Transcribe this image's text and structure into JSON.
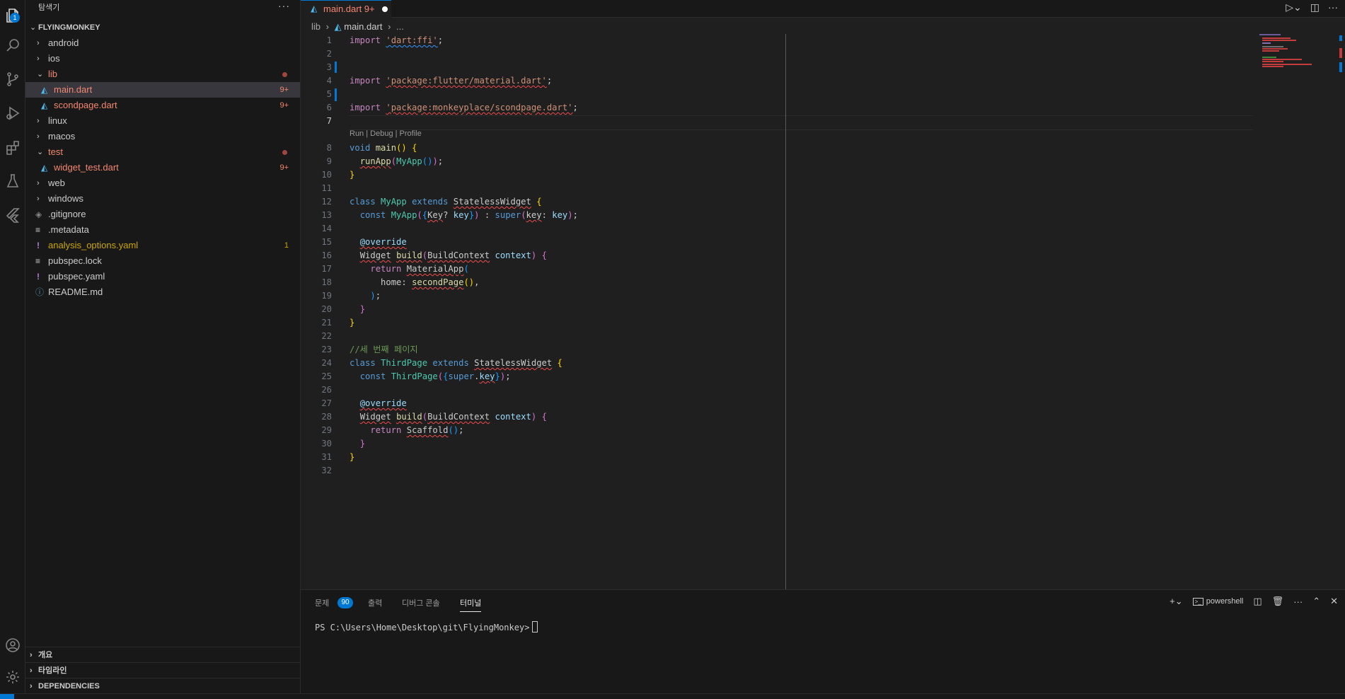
{
  "explorer": {
    "title": "탐색기",
    "more": "···",
    "root": "FLYINGMONKEY",
    "items": [
      {
        "label": "android",
        "chev": "›",
        "indent": 0
      },
      {
        "label": "ios",
        "chev": "›",
        "indent": 0
      },
      {
        "label": "lib",
        "chev": "⌄",
        "indent": 0
      },
      {
        "label": "main.dart",
        "badge": "9+"
      },
      {
        "label": "scondpage.dart",
        "badge": "9+"
      },
      {
        "label": "linux",
        "chev": "›"
      },
      {
        "label": "macos",
        "chev": "›"
      },
      {
        "label": "test",
        "chev": "⌄"
      },
      {
        "label": "widget_test.dart",
        "badge": "9+"
      },
      {
        "label": "web",
        "chev": "›"
      },
      {
        "label": "windows",
        "chev": "›"
      },
      {
        "label": ".gitignore",
        "icon": "◈"
      },
      {
        "label": ".metadata",
        "icon": "≡"
      },
      {
        "label": "analysis_options.yaml",
        "icon": "!",
        "badge": "1"
      },
      {
        "label": "pubspec.lock",
        "icon": "≡"
      },
      {
        "label": "pubspec.yaml",
        "icon": "!"
      },
      {
        "label": "README.md",
        "icon": "ⓘ"
      }
    ],
    "bottom_sections": [
      "개요",
      "타임라인",
      "DEPENDENCIES"
    ]
  },
  "activity": {
    "explorer_badge": "1"
  },
  "tabs": [
    {
      "label": "main.dart 9+",
      "dirty": true
    }
  ],
  "breadcrumb": {
    "folder": "lib",
    "sep1": "›",
    "file": "main.dart",
    "sep2": "›",
    "rest": "..."
  },
  "editor": {
    "codelens": "Run | Debug | Profile",
    "current_line": 7,
    "line_numbers": [
      "1",
      "2",
      "3",
      "4",
      "5",
      "6",
      "7",
      "8",
      "9",
      "10",
      "11",
      "12",
      "13",
      "14",
      "15",
      "16",
      "17",
      "18",
      "19",
      "20",
      "21",
      "22",
      "23",
      "24",
      "25",
      "26",
      "27",
      "28",
      "29",
      "30",
      "31",
      "32"
    ]
  },
  "panel": {
    "tabs": [
      "문제",
      "출력",
      "디버그 콘솔",
      "터미널"
    ],
    "problems_count": "90",
    "active_tab": "터미널",
    "shell": "powershell",
    "prompt": "PS C:\\Users\\Home\\Desktop\\git\\FlyingMonkey>"
  },
  "colors": {
    "accent": "#0078d4",
    "error": "#f48771",
    "background": "#1f1f1f",
    "sidebar": "#181818"
  }
}
